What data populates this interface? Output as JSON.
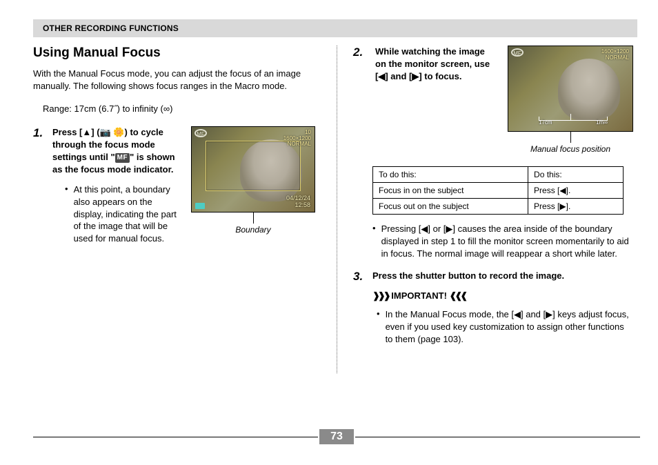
{
  "header": "OTHER RECORDING FUNCTIONS",
  "title": "Using Manual Focus",
  "intro": "With the Manual Focus mode, you can adjust the focus of an image manually. The following shows focus ranges in the Macro mode.",
  "range": "Range: 17cm (6.7˝) to infinity (∞)",
  "step1": {
    "num": "1.",
    "text_before": "Press [",
    "up": "▲",
    "text_mid1": "] (",
    "icons": "📷 🌼",
    "text_mid2": ") to cycle through the focus mode settings until \"",
    "mf_chip": "MF",
    "text_after": "\" is shown as the focus mode indicator.",
    "bullet": "At this point, a boundary also appears on the display, indicating the part of the image that will be used for manual focus."
  },
  "fig1": {
    "tl": "MF",
    "res": "1600×1200",
    "quality": "NORMAL",
    "count": "10",
    "date": "04/12/24",
    "time": "12:58",
    "caption": "Boundary"
  },
  "step2": {
    "num": "2.",
    "text_before": "While watching the image on the monitor screen, use [",
    "left": "◀",
    "mid": "] and [",
    "right": "▶",
    "after": "] to focus."
  },
  "fig2": {
    "tl": "MF",
    "res": "1600×1200",
    "quality": "NORMAL",
    "scale_left": "17cm",
    "scale_right": "1m∞",
    "caption": "Manual focus position"
  },
  "table": {
    "h1": "To do this:",
    "h2": "Do this:",
    "r1c1": "Focus in on the subject",
    "r1c2_a": "Press [",
    "r1c2_b": "◀",
    "r1c2_c": "].",
    "r2c1": "Focus out on the subject",
    "r2c2_a": "Press [",
    "r2c2_b": "▶",
    "r2c2_c": "]."
  },
  "note": {
    "a": "Pressing [",
    "l": "◀",
    "b": "] or [",
    "r": "▶",
    "c": "] causes the area inside of the boundary displayed in step 1 to fill the monitor screen momentarily to aid in focus. The normal image will reappear a short while later."
  },
  "step3": {
    "num": "3.",
    "text": "Press the shutter button to record the image."
  },
  "important": {
    "deco_l": "❱❱❱",
    "label": " IMPORTANT! ",
    "deco_r": "❰❰❰",
    "a": "In the Manual Focus mode, the [",
    "l": "◀",
    "b": "] and [",
    "r": "▶",
    "c": "] keys adjust focus, even if you used key customization to assign other functions to them (page 103)."
  },
  "page": "73"
}
